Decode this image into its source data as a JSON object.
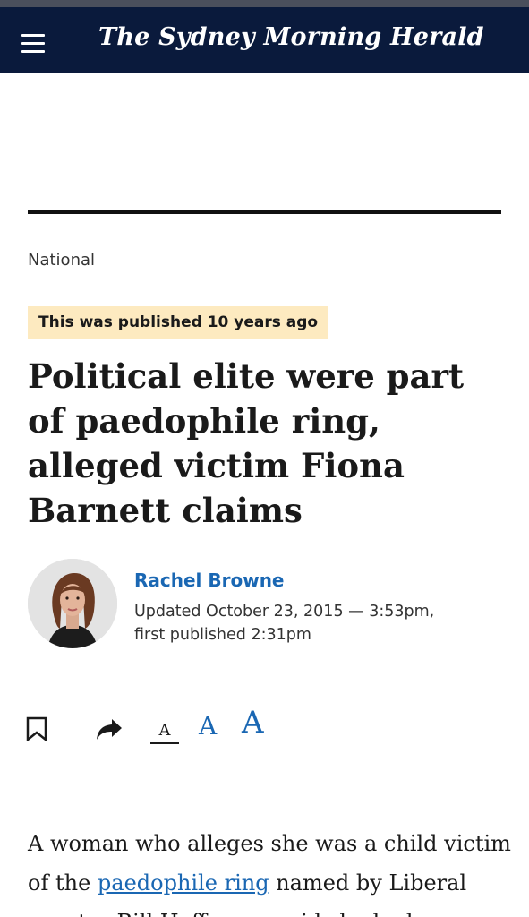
{
  "header": {
    "title": "The Sydney Morning Herald",
    "menu_icon": "hamburger-menu-icon",
    "background": "#0a1a3c"
  },
  "article": {
    "section": "National",
    "age_badge": "This was published 10 years ago",
    "headline": "Political elite were part of paedophile ring, alleged victim Fiona Barnett claims",
    "author": "Rachel Browne",
    "updated_line": "Updated October 23, 2015 — 3:53pm,",
    "first_published": "first published 2:31pm",
    "body_start": "A woman who alleges she was a child victim of the",
    "body_link": "paedophile ring",
    "body_rest": " named by Liberal senator Bill Heffernan said she had"
  },
  "toolbar": {
    "bookmark_icon": "bookmark-icon",
    "share_icon": "share-icon",
    "font_small": "A",
    "font_medium": "A",
    "font_large": "A"
  },
  "colors": {
    "accent": "#1a67b3",
    "badge": "#fdeac0",
    "rule": "#111111"
  }
}
